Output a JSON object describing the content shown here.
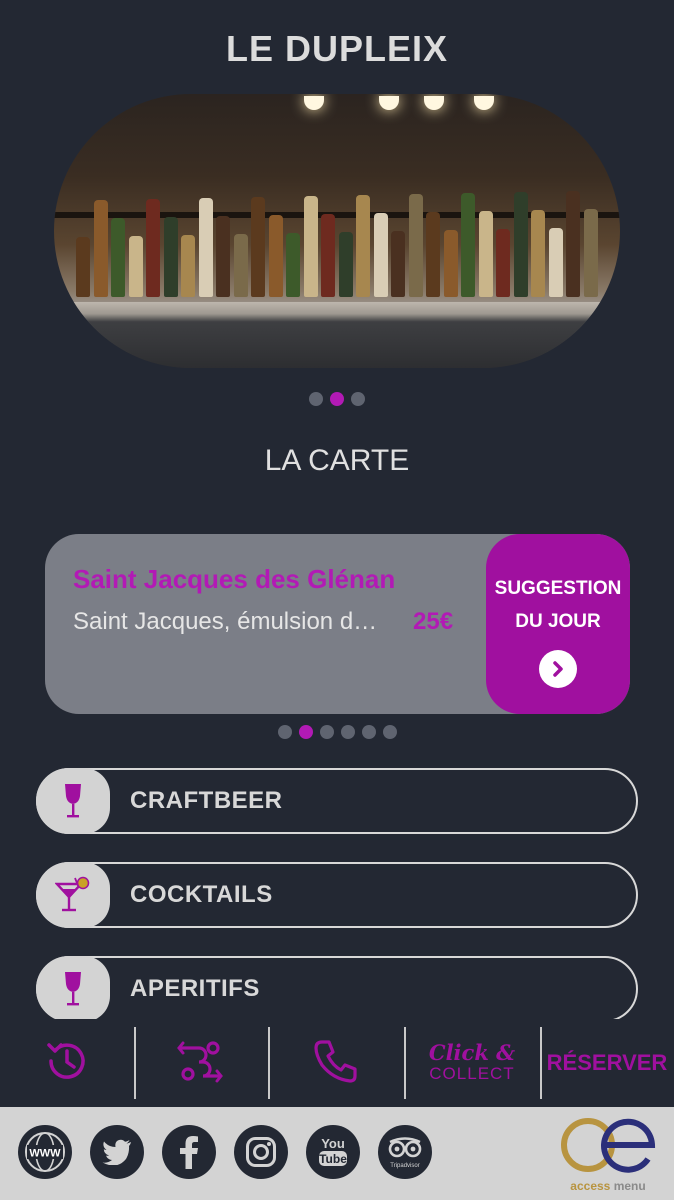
{
  "header": {
    "title": "LE DUPLEIX"
  },
  "hero": {
    "image": "bar-shelves-with-bottles",
    "slides": 3,
    "active_slide": 2
  },
  "menu": {
    "section_title": "LA CARTE",
    "featured": {
      "name": "Saint Jacques des Glénan",
      "description": "Saint Jacques, émulsion d…",
      "price": "25€",
      "badge_line1": "SUGGESTION",
      "badge_line2": "DU JOUR"
    },
    "carousel": {
      "count": 6,
      "active": 2
    },
    "categories": [
      {
        "label": "CRAFTBEER",
        "icon": "wine-glass-icon"
      },
      {
        "label": "COCKTAILS",
        "icon": "cocktail-icon"
      },
      {
        "label": "APERITIFS",
        "icon": "wine-glass-icon"
      }
    ]
  },
  "actions": {
    "history_icon": "history-icon",
    "route_icon": "route-icon",
    "phone_icon": "phone-icon",
    "click_top": "Click &",
    "click_bottom": "COLLECT",
    "reserve": "RÉSERVER"
  },
  "footer": {
    "social": [
      "www-icon",
      "twitter-icon",
      "facebook-icon",
      "instagram-icon",
      "youtube-icon",
      "tripadvisor-icon"
    ],
    "www_text": "WWW",
    "youtube_top": "You",
    "youtube_bottom": "Tube",
    "tripadvisor_text": "Tripadvisor",
    "brand_word1": "access",
    "brand_word2": "menu"
  },
  "colors": {
    "accent": "#a0109f",
    "background": "#232833",
    "card": "#7b7e87",
    "footer": "#d3d3d3"
  }
}
